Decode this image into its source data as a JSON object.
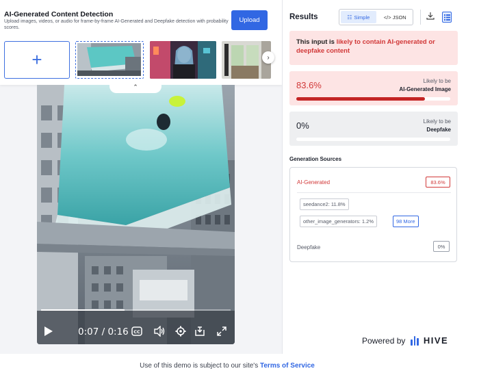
{
  "app": {
    "title": "AI-Generated Content Detection",
    "subtitle": "Upload images, videos, or audio for frame-by-frame AI-Generated and Deepfake detection with probability scores.",
    "upload_label": "Upload",
    "add_symbol": "+"
  },
  "video": {
    "time_display": "0:07 / 0:16",
    "progress_fraction": 0.44
  },
  "results": {
    "title": "Results",
    "toggle": {
      "simple_label": "Simple",
      "json_label": "</> JSON",
      "active": "simple"
    },
    "alert": {
      "prefix": "This input is ",
      "highlight": "likely to contain AI-generated or deepfake content"
    },
    "ai_card": {
      "value": "83.6%",
      "label_top": "Likely to be",
      "label_bottom": "AI-Generated Image",
      "fraction": 0.836
    },
    "deepfake_card": {
      "value": "0%",
      "label_top": "Likely to be",
      "label_bottom": "Deepfake",
      "fraction": 0
    },
    "sources": {
      "title": "Generation Sources",
      "ai_label": "AI-Generated",
      "ai_value": "83.6%",
      "chips": [
        "seedance2: 11.8%",
        "other_image_generators: 1.2%"
      ],
      "more_label": "98 More",
      "deepfake_label": "Deepfake",
      "deepfake_value": "0%"
    }
  },
  "branding": {
    "powered_by": "Powered by",
    "logo_text": "HIVE"
  },
  "footer": {
    "text": "Use of this demo is subject to our site's ",
    "link": "Terms of Service"
  },
  "colors": {
    "accent": "#3167e3",
    "danger": "#d13838",
    "alert_bg": "#fde4e4"
  }
}
